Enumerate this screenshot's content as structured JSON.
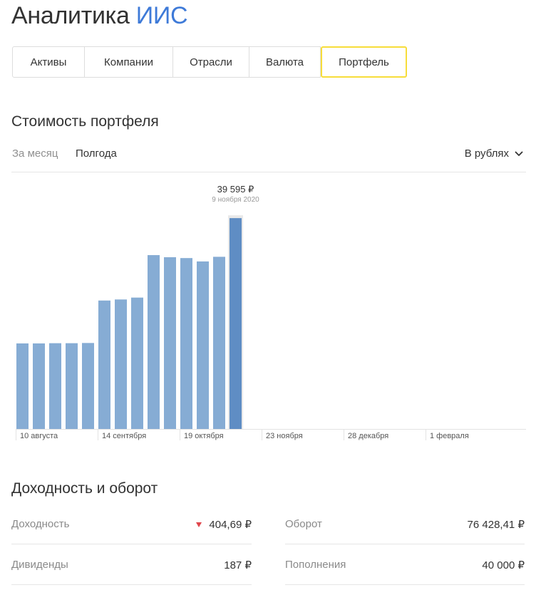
{
  "page": {
    "title_main": "Аналитика",
    "title_accent": "ИИС"
  },
  "tabs": [
    "Активы",
    "Компании",
    "Отрасли",
    "Валюта",
    "Портфель"
  ],
  "active_tab_index": 4,
  "colors": {
    "accent": "#3e7ad8",
    "tab_active_border": "#f7dd3a",
    "bar": "#86acd4",
    "bar_selected": "#5f8dc4",
    "negative": "#e0454b"
  },
  "portfolio": {
    "heading": "Стоимость портфеля",
    "periods": [
      "За месяц",
      "Полгода"
    ],
    "selected_period": "Полгода",
    "currency_label": "В рублях",
    "currency_icon": "chevron-down-icon"
  },
  "chart_data": {
    "type": "bar",
    "title": "",
    "xlabel": "",
    "ylabel": "",
    "x_ticks": [
      "10 августа",
      "14 сентября",
      "19 октября",
      "23 ноября",
      "28 декабря",
      "1 февраля"
    ],
    "values": [
      20350,
      20350,
      20400,
      20400,
      20450,
      30550,
      30800,
      31250,
      41350,
      40850,
      40650,
      39850,
      40950,
      50150
    ],
    "y_axis_visible": false,
    "selected_index": 13,
    "tooltip": {
      "value": "39 595 ₽",
      "date": "9 ноября 2020"
    }
  },
  "returns": {
    "heading": "Доходность и оборот",
    "left": [
      {
        "label": "Доходность",
        "value": "404,69 ₽",
        "trend": "down"
      },
      {
        "label": "Дивиденды",
        "value": "187 ₽"
      }
    ],
    "right": [
      {
        "label": "Оборот",
        "value": "76 428,41 ₽"
      },
      {
        "label": "Пополнения",
        "value": "40 000 ₽"
      }
    ]
  }
}
